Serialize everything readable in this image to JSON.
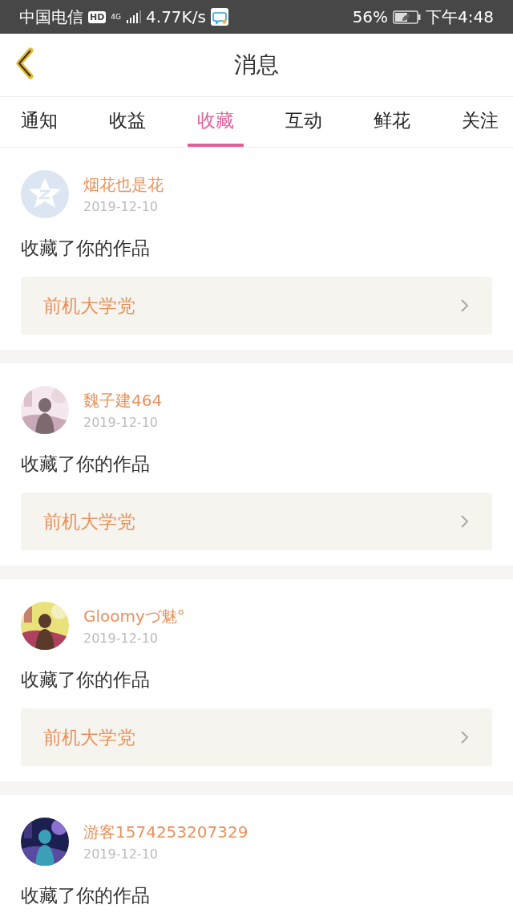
{
  "status_bar": {
    "carrier": "中国电信",
    "hd": "HD",
    "network": "4G",
    "speed": "4.77K/s",
    "battery": "56%",
    "time": "下午4:48"
  },
  "header": {
    "title": "消息"
  },
  "tabs": [
    {
      "label": "通知",
      "selected": false
    },
    {
      "label": "收益",
      "selected": false
    },
    {
      "label": "收藏",
      "selected": true
    },
    {
      "label": "互动",
      "selected": false
    },
    {
      "label": "鲜花",
      "selected": false
    },
    {
      "label": "关注",
      "selected": false
    }
  ],
  "messages": [
    {
      "avatar": {
        "kind": "default"
      },
      "name": "烟花也是花",
      "date": "2019-12-10",
      "text": "收藏了你的作品",
      "work": "前机大学党"
    },
    {
      "name": "魏子建464",
      "date": "2019-12-10",
      "text": "收藏了你的作品",
      "work": "前机大学党"
    },
    {
      "name": "Gloomyづ魅°",
      "date": "2019-12-10",
      "text": "收藏了你的作品",
      "work": "前机大学党"
    },
    {
      "name": "游客1574253207329",
      "date": "2019-12-10",
      "text": "收藏了你的作品"
    }
  ]
}
